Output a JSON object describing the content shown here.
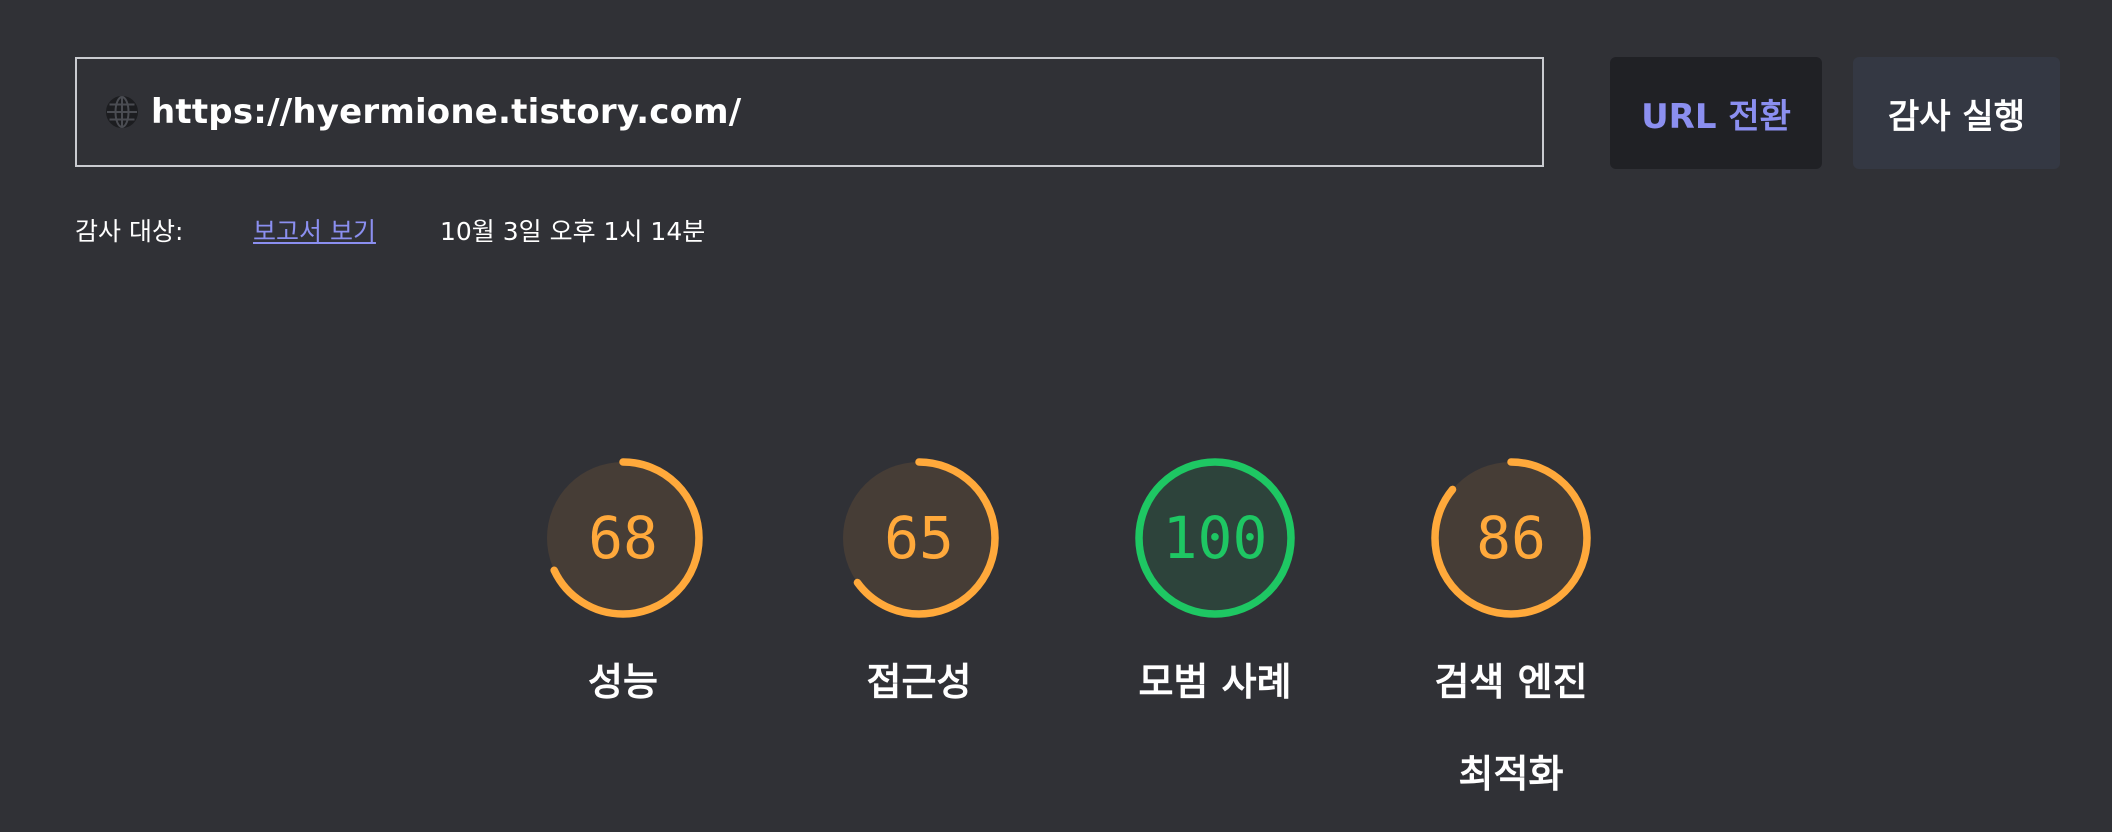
{
  "url_bar": {
    "value": "https://hyermione.tistory.com/",
    "icon": "globe-icon"
  },
  "buttons": {
    "switch_url": "URL 전환",
    "run_audit": "감사 실행"
  },
  "meta": {
    "label": "감사 대상:",
    "report_link": "보고서 보기",
    "timestamp": "10월 3일 오후 1시 14분"
  },
  "colors": {
    "background": "#303136",
    "average": "#ffa93b",
    "average_bg": "#463d36",
    "pass": "#1ec763",
    "pass_bg": "#2d433b",
    "link": "#8b8ff0"
  },
  "scores": [
    {
      "label": "성능",
      "value": "68",
      "score": 68,
      "status": "average"
    },
    {
      "label": "접근성",
      "value": "65",
      "score": 65,
      "status": "average"
    },
    {
      "label": "모범 사례",
      "value": "100",
      "score": 100,
      "status": "pass"
    },
    {
      "label": "검색 엔진 최적화",
      "value": "86",
      "score": 86,
      "status": "average"
    }
  ]
}
